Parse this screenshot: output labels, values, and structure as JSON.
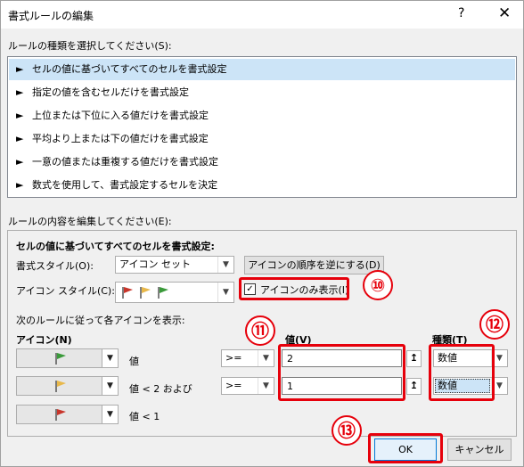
{
  "dialog": {
    "title": "書式ルールの編集",
    "help": "?",
    "close": "✕"
  },
  "rule_type": {
    "label": "ルールの種類を選択してください(S):",
    "items": [
      "セルの値に基づいてすべてのセルを書式設定",
      "指定の値を含むセルだけを書式設定",
      "上位または下位に入る値だけを書式設定",
      "平均より上または下の値だけを書式設定",
      "一意の値または重複する値だけを書式設定",
      "数式を使用して、書式設定するセルを決定"
    ],
    "selected_index": 0
  },
  "rule_edit": {
    "label": "ルールの内容を編集してください(E):",
    "heading": "セルの値に基づいてすべてのセルを書式設定:",
    "format_style_label": "書式スタイル(O):",
    "format_style_value": "アイコン セット",
    "reverse_button": "アイコンの順序を逆にする(D)",
    "icon_style_label": "アイコン スタイル(C):",
    "show_icon_only_label": "アイコンのみ表示(I)",
    "show_icon_only_checked": true,
    "rules_caption": "次のルールに従って各アイコンを表示:",
    "col_icon": "アイコン(N)",
    "col_value": "値(V)",
    "col_type": "種類(T)",
    "rows": [
      {
        "cond": "値",
        "op": ">=",
        "value": "2",
        "type": "数値",
        "flag_color": "#3a9a3a"
      },
      {
        "cond": "値 < 2 および",
        "op": ">=",
        "value": "1",
        "type": "数値",
        "flag_color": "#e8b84a"
      },
      {
        "cond": "値 < 1",
        "flag_color": "#c8352b"
      }
    ]
  },
  "buttons": {
    "ok": "OK",
    "cancel": "キャンセル"
  },
  "callouts": {
    "c10": "⑩",
    "c11": "⑪",
    "c12": "⑫",
    "c13": "⑬"
  },
  "colors": {
    "highlight": "#e6000b",
    "selection": "#cce4f7",
    "type_selected": "#cce4f7"
  },
  "icons": {
    "item_arrow": "right-arrow-icon",
    "dropdown": "chevron-down-icon",
    "spin": "up-arrow-icon",
    "flag": "flag-icon"
  }
}
